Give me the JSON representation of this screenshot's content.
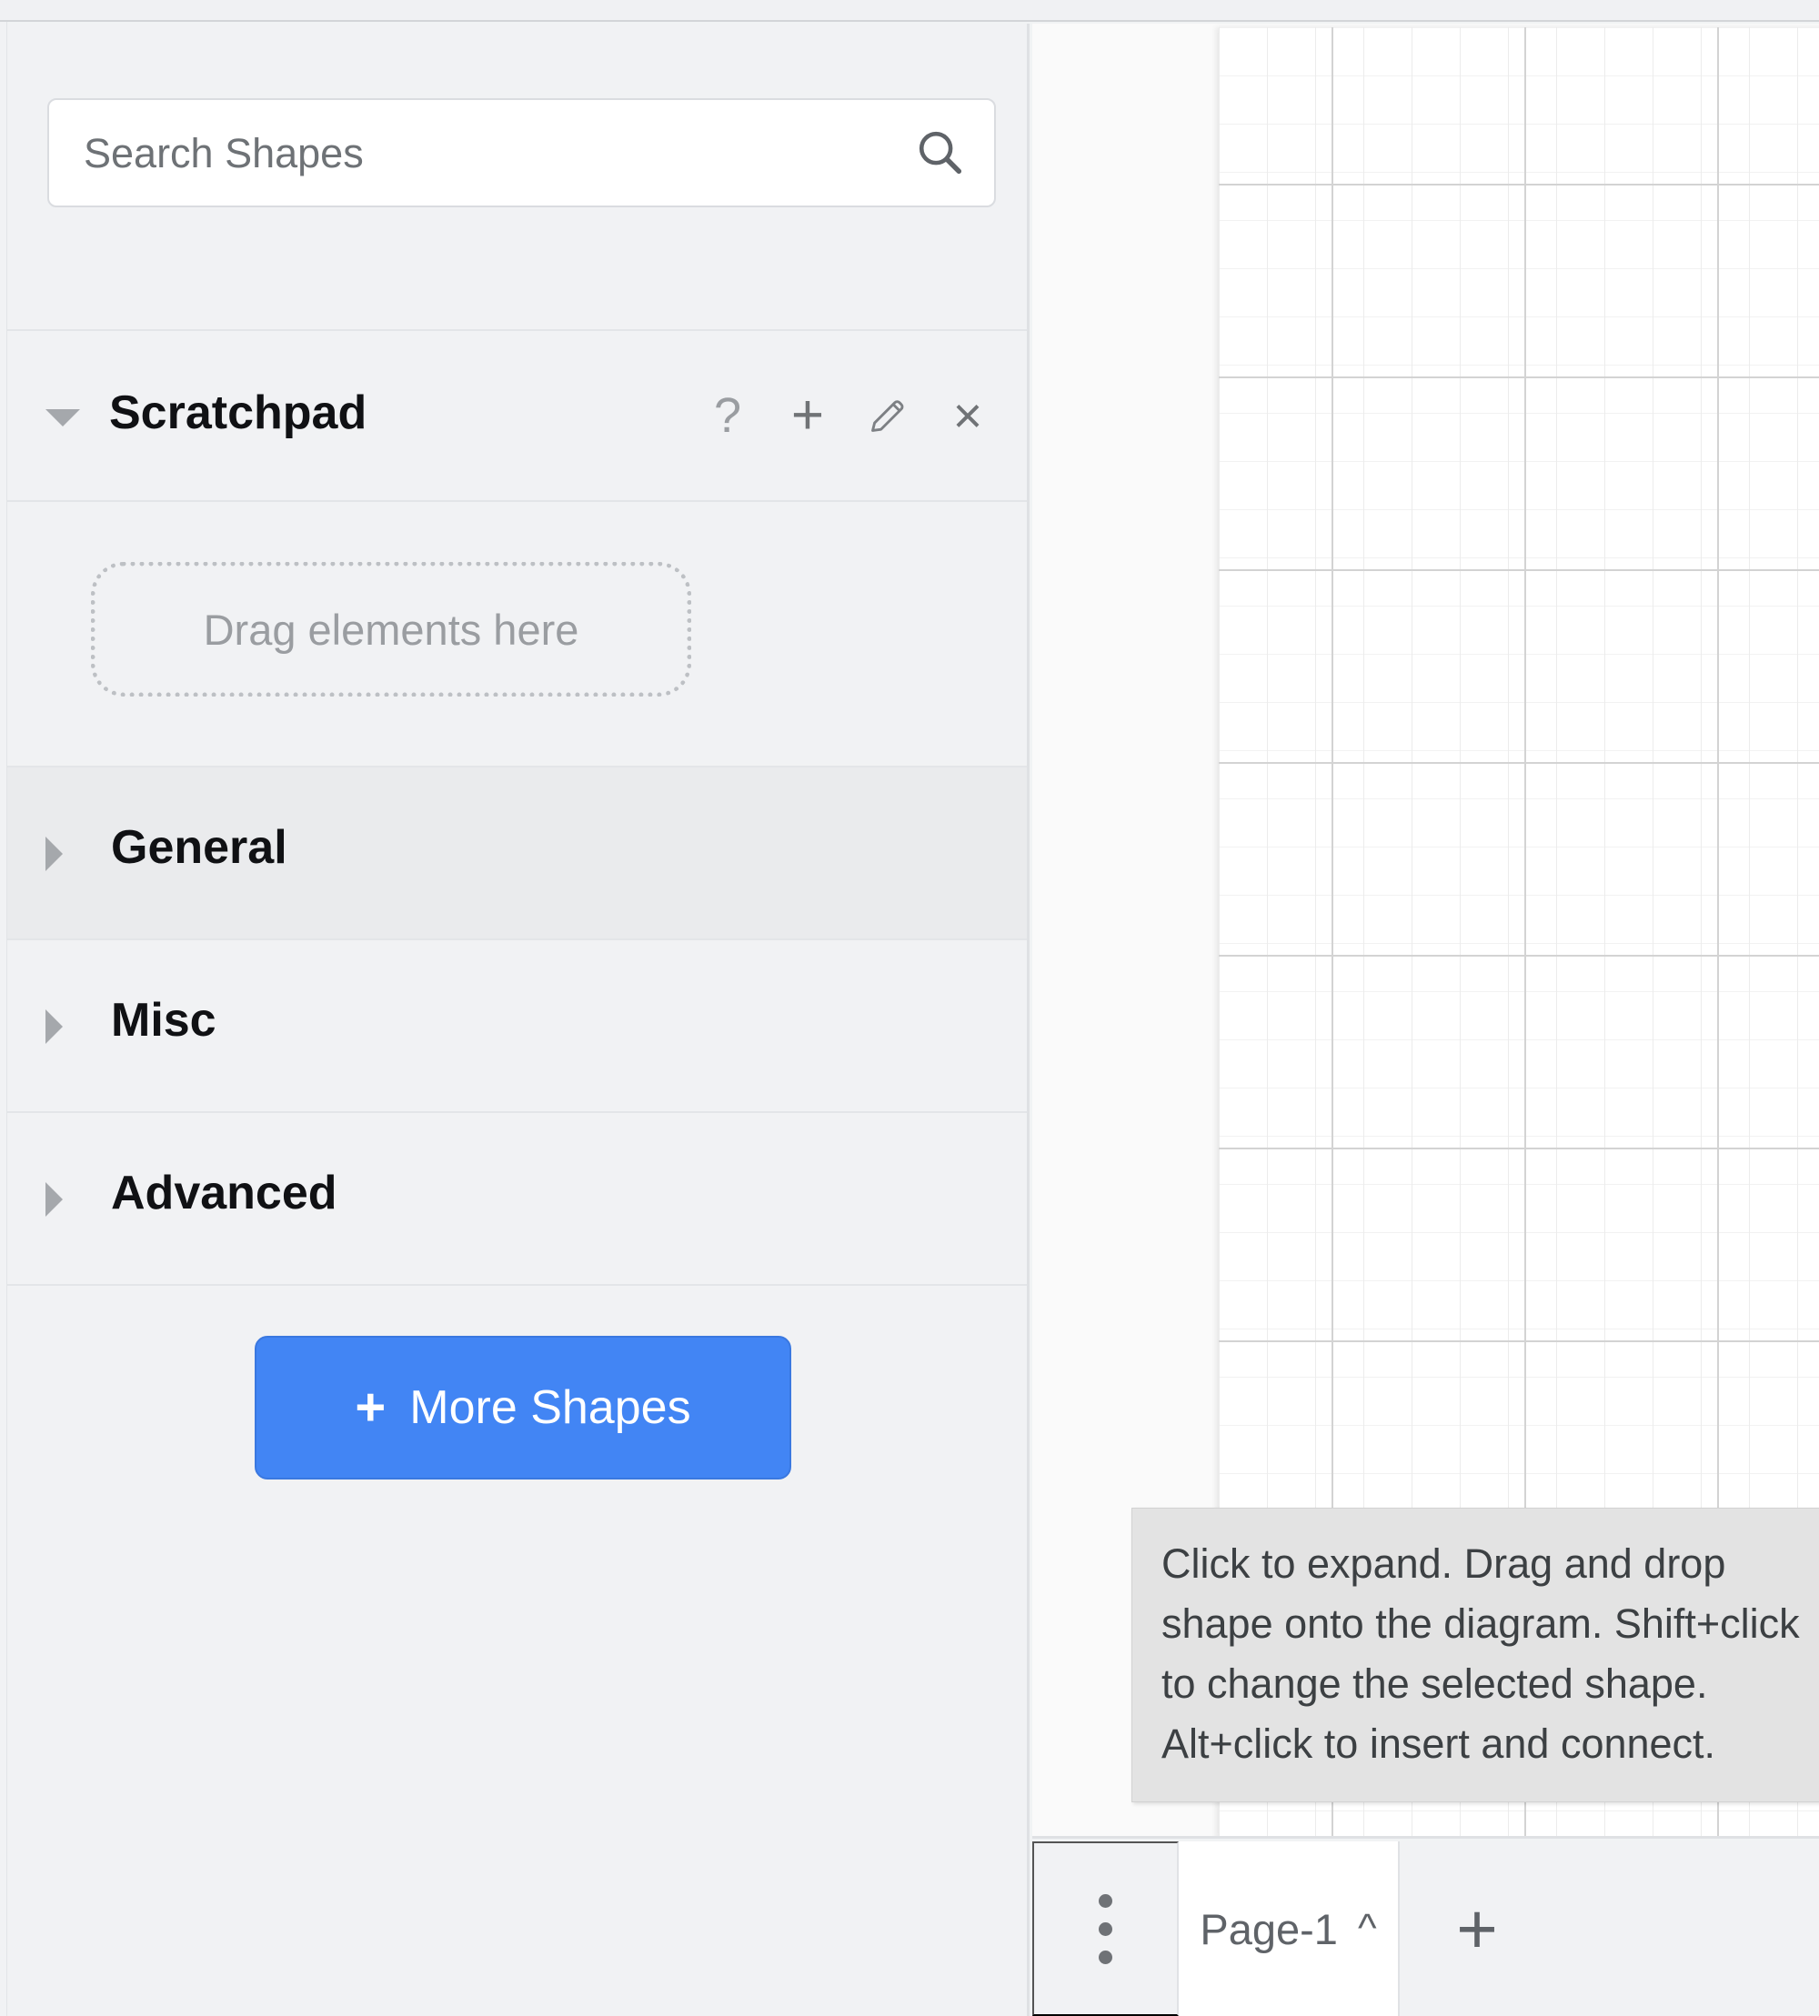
{
  "sidebar": {
    "search": {
      "placeholder": "Search Shapes",
      "value": "",
      "icon": "search-icon"
    },
    "scratchpad": {
      "title": "Scratchpad",
      "expanded": true,
      "toggle_icon": "caret-down-icon",
      "actions": [
        {
          "name": "help-icon",
          "glyph": "?"
        },
        {
          "name": "add-icon",
          "glyph": "+"
        },
        {
          "name": "edit-pencil-icon",
          "glyph": "pencil"
        },
        {
          "name": "close-icon",
          "glyph": "×"
        }
      ],
      "drop_zone_label": "Drag elements here"
    },
    "palettes": [
      {
        "label": "General",
        "expanded": false,
        "highlighted": true,
        "toggle_icon": "caret-right-icon"
      },
      {
        "label": "Misc",
        "expanded": false,
        "highlighted": false,
        "toggle_icon": "caret-right-icon"
      },
      {
        "label": "Advanced",
        "expanded": false,
        "highlighted": false,
        "toggle_icon": "caret-right-icon"
      }
    ],
    "more_shapes": {
      "label": "More Shapes",
      "plus_glyph": "+",
      "accent_color": "#4285f4"
    }
  },
  "canvas": {
    "grid_visible": true,
    "page_background": "#ffffff",
    "tooltip": {
      "text": "Click to expand. Drag and drop shape onto the diagram. Shift+click to change the selected shape. Alt+click to insert and connect."
    }
  },
  "page_bar": {
    "menu_icon": "more-vertical-icon",
    "tab_label": "Page-1",
    "tab_caret_glyph": "^",
    "add_glyph": "+"
  }
}
